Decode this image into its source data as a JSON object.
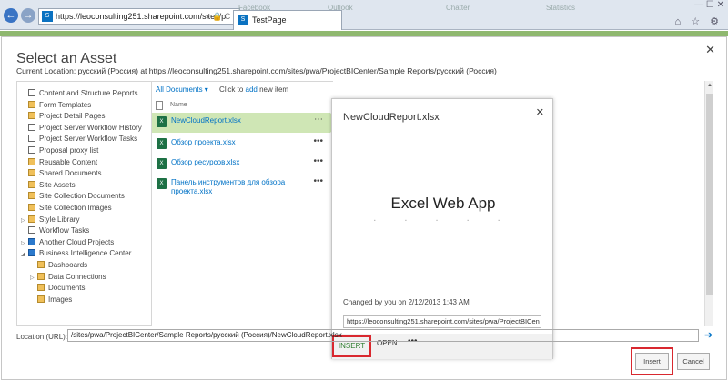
{
  "browser": {
    "address_text": "https://leoconsulting251.sharepoint.com/sites/p",
    "tab_title": "TestPage",
    "ghost_tabs": [
      "Facebook",
      "Outlook",
      "Chatter",
      "Statistics"
    ],
    "nav_back": "←",
    "nav_forward": "→",
    "address_icons": "▾ 🔒 C ×",
    "window_controls": "— ☐ ✕",
    "toolbar_icons": "⌂ ☆ ⚙"
  },
  "dialog": {
    "title": "Select an Asset",
    "close": "✕",
    "current_location": "Current Location: русский (Россия) at https://leoconsulting251.sharepoint.com/sites/pwa/ProjectBICenter/Sample Reports/русский (Россия)",
    "tree": [
      {
        "label": "Content and Structure Reports",
        "icon": "list-icon",
        "indent": 0
      },
      {
        "label": "Form Templates",
        "icon": "library-icon",
        "indent": 0
      },
      {
        "label": "Project Detail Pages",
        "icon": "library-icon",
        "indent": 0
      },
      {
        "label": "Project Server Workflow History",
        "icon": "list-icon",
        "indent": 0
      },
      {
        "label": "Project Server Workflow Tasks",
        "icon": "list-icon",
        "indent": 0
      },
      {
        "label": "Proposal proxy list",
        "icon": "list-icon",
        "indent": 0
      },
      {
        "label": "Reusable Content",
        "icon": "library-icon",
        "indent": 0
      },
      {
        "label": "Shared Documents",
        "icon": "library-icon",
        "indent": 0
      },
      {
        "label": "Site Assets",
        "icon": "library-icon",
        "indent": 0
      },
      {
        "label": "Site Collection Documents",
        "icon": "library-icon",
        "indent": 0
      },
      {
        "label": "Site Collection Images",
        "icon": "library-icon",
        "indent": 0
      },
      {
        "label": "Style Library",
        "icon": "library-icon",
        "indent": 0,
        "expander": "▷"
      },
      {
        "label": "Workflow Tasks",
        "icon": "list-icon",
        "indent": 0
      },
      {
        "label": "Another Cloud Projects",
        "icon": "site-icon",
        "indent": 0,
        "expander": "▷"
      },
      {
        "label": "Business Intelligence Center",
        "icon": "site-icon",
        "indent": 0,
        "expander": "◢"
      },
      {
        "label": "Dashboards",
        "icon": "library-icon",
        "indent": 1
      },
      {
        "label": "Data Connections",
        "icon": "library-icon",
        "indent": 1,
        "expander": "▷"
      },
      {
        "label": "Documents",
        "icon": "library-icon",
        "indent": 1
      },
      {
        "label": "Images",
        "icon": "library-icon",
        "indent": 1
      }
    ],
    "files": {
      "view_label": "All Documents ▾",
      "add_prefix": "Click to ",
      "add_link": "add",
      "add_suffix": " new item",
      "column_name": "Name",
      "items": [
        {
          "name": "NewCloudReport.xlsx",
          "selected": true,
          "menu": "⋯"
        },
        {
          "name": "Обзор проекта.xlsx",
          "selected": false,
          "menu": "•••"
        },
        {
          "name": "Обзор ресурсов.xlsx",
          "selected": false,
          "menu": "•••"
        },
        {
          "name": "Панель инструментов для обзора проекта.xlsx",
          "selected": false,
          "menu": "•••"
        }
      ],
      "xls_glyph": "X"
    },
    "callout": {
      "title": "NewCloudReport.xlsx",
      "close": "✕",
      "app_name": "Excel Web App",
      "loading_dots": ". . . . .",
      "changed": "Changed by you on 2/12/2013 1:43 AM",
      "url": "https://leoconsulting251.sharepoint.com/sites/pwa/ProjectBICen",
      "insert": "INSERT",
      "open": "OPEN",
      "more": "•••"
    },
    "location_label": "Location (URL):",
    "location_value": "/sites/pwa/ProjectBICenter/Sample Reports/русский (Россия)/NewCloudReport.xlsx",
    "location_go": "➔",
    "insert_button": "Insert",
    "cancel_button": "Cancel"
  }
}
